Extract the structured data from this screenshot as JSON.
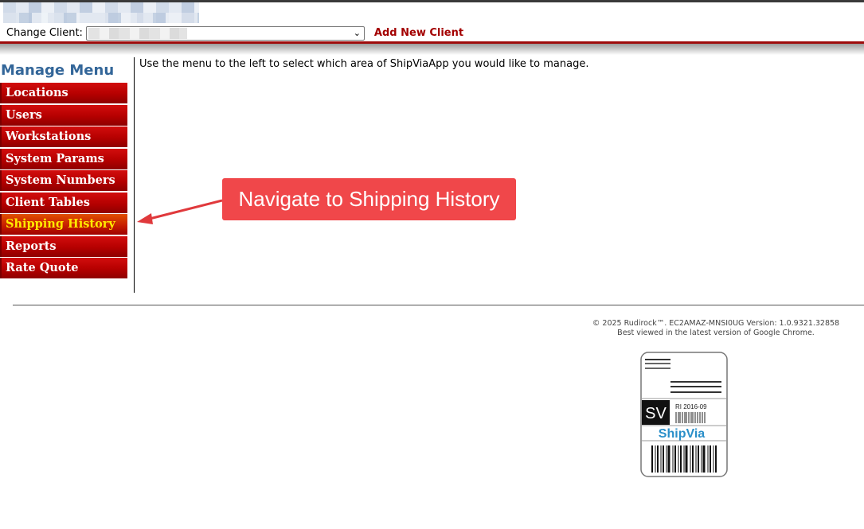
{
  "header": {
    "change_client_label": "Change Client:",
    "client_select_value": "",
    "add_client_label": "Add New Client"
  },
  "sidebar": {
    "title": "Manage Menu",
    "items": [
      {
        "label": "Locations",
        "active": false
      },
      {
        "label": "Users",
        "active": false
      },
      {
        "label": "Workstations",
        "active": false
      },
      {
        "label": "System Params",
        "active": false
      },
      {
        "label": "System Numbers",
        "active": false
      },
      {
        "label": "Client Tables",
        "active": false
      },
      {
        "label": "Shipping History",
        "active": true
      },
      {
        "label": "Reports",
        "active": false
      },
      {
        "label": "Rate Quote",
        "active": false
      }
    ]
  },
  "main": {
    "instructions": "Use the menu to the left to select which area of ShipViaApp you would like to manage."
  },
  "callout": {
    "text": "Navigate to Shipping History"
  },
  "footer": {
    "copyright": "© 2025 Rudirock™. EC2AMAZ-MNSI0UG Version: 1.0.9321.32858",
    "browser_note": "Best viewed in the latest version of Google Chrome."
  },
  "badge": {
    "initials": "SV",
    "code": "RI 2016-09",
    "brand": "ShipVia"
  },
  "colors": {
    "menu_red": "#b50000",
    "menu_active_text": "#ffea00",
    "title_blue": "#336699",
    "callout_bg": "#f0474a",
    "add_client_red": "#a30000"
  }
}
